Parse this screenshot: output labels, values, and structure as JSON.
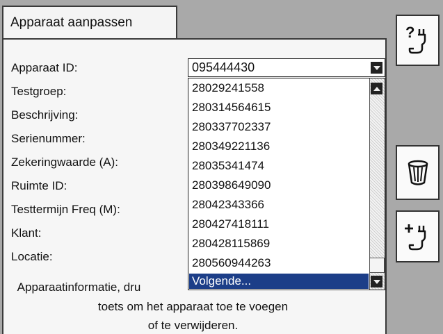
{
  "tab": {
    "label": "Apparaat aanpassen"
  },
  "fields": [
    {
      "label": "Apparaat ID:"
    },
    {
      "label": "Testgroep:"
    },
    {
      "label": "Beschrijving:"
    },
    {
      "label": "Serienummer:"
    },
    {
      "label": "Zekeringwaarde (A):"
    },
    {
      "label": "Ruimte ID:"
    },
    {
      "label": "Testtermijn Freq (M):"
    },
    {
      "label": "Klant:"
    },
    {
      "label": "Locatie:"
    }
  ],
  "dropdown": {
    "selected": "095444430",
    "options": [
      "28029241558",
      "280314564615",
      "280337702337",
      "280349221136",
      "28035341474",
      "280398649090",
      "28042343366",
      "280427418111",
      "280428115869",
      "280560944263"
    ],
    "highlighted": "Volgende..."
  },
  "info": {
    "line1": "Apparaatinformatie, dru",
    "line2": "toets om het apparaat toe te voegen",
    "line3": "of te verwijderen."
  },
  "side_buttons": [
    {
      "icon": "help-plug-icon"
    },
    {
      "icon": "trash-icon"
    },
    {
      "icon": "add-plug-icon"
    }
  ],
  "colors": {
    "highlight": "#1c3e88",
    "background": "#a9a9a9"
  }
}
